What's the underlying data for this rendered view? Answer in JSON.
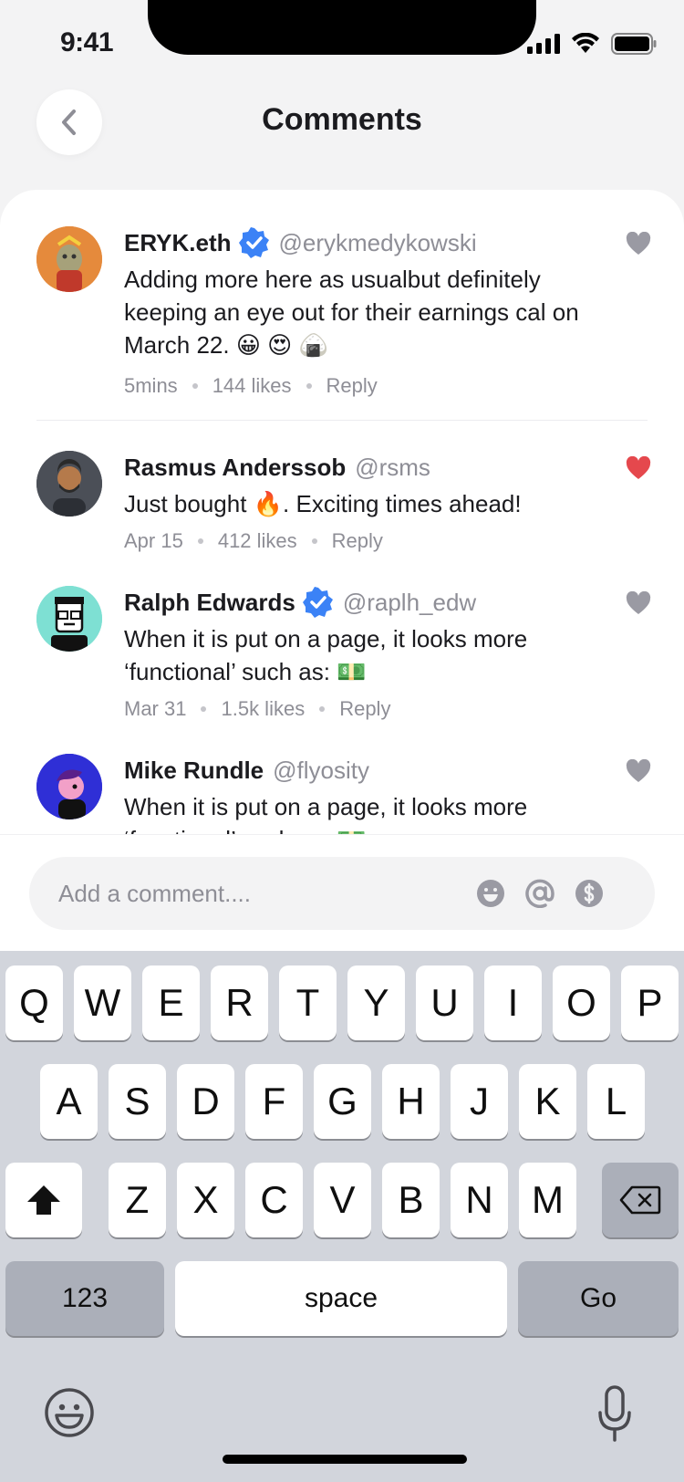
{
  "status": {
    "time": "9:41"
  },
  "header": {
    "title": "Comments"
  },
  "comments": [
    {
      "name": "ERYK.eth",
      "verified": true,
      "handle": "@erykmedykowski",
      "text": "Adding more here as usualbut definitely keeping an eye out for their earnings cal on March 22. 😀 😍 🍙",
      "time": "5mins",
      "likes": "144 likes",
      "reply": "Reply",
      "liked": false
    },
    {
      "name": "Rasmus Anderssob",
      "verified": false,
      "handle": "@rsms",
      "text": "Just bought 🔥. Exciting times ahead!",
      "time": "Apr 15",
      "likes": "412 likes",
      "reply": "Reply",
      "liked": true
    },
    {
      "name": "Ralph Edwards",
      "verified": true,
      "handle": "@raplh_edw",
      "text": "When it is put on a page, it looks more ‘functional’ such as: 💵",
      "time": "Mar 31",
      "likes": "1.5k likes",
      "reply": "Reply",
      "liked": false
    },
    {
      "name": "Mike Rundle",
      "verified": false,
      "handle": "@flyosity",
      "text": "When it is put on a page, it looks more ‘functional’ such as: 💵",
      "liked": false
    }
  ],
  "composer": {
    "placeholder": "Add a comment....",
    "icons": [
      "emoji-icon",
      "mention-icon",
      "dollar-icon"
    ]
  },
  "keyboard": {
    "row1": [
      "Q",
      "W",
      "E",
      "R",
      "T",
      "Y",
      "U",
      "I",
      "O",
      "P"
    ],
    "row2": [
      "A",
      "S",
      "D",
      "F",
      "G",
      "H",
      "J",
      "K",
      "L"
    ],
    "row3": [
      "Z",
      "X",
      "C",
      "V",
      "B",
      "N",
      "M"
    ],
    "numbers_label": "123",
    "space_label": "space",
    "go_label": "Go"
  },
  "colors": {
    "accent_blue": "#3b82f6",
    "like_red": "#e5484d",
    "muted": "#8e8e96"
  }
}
